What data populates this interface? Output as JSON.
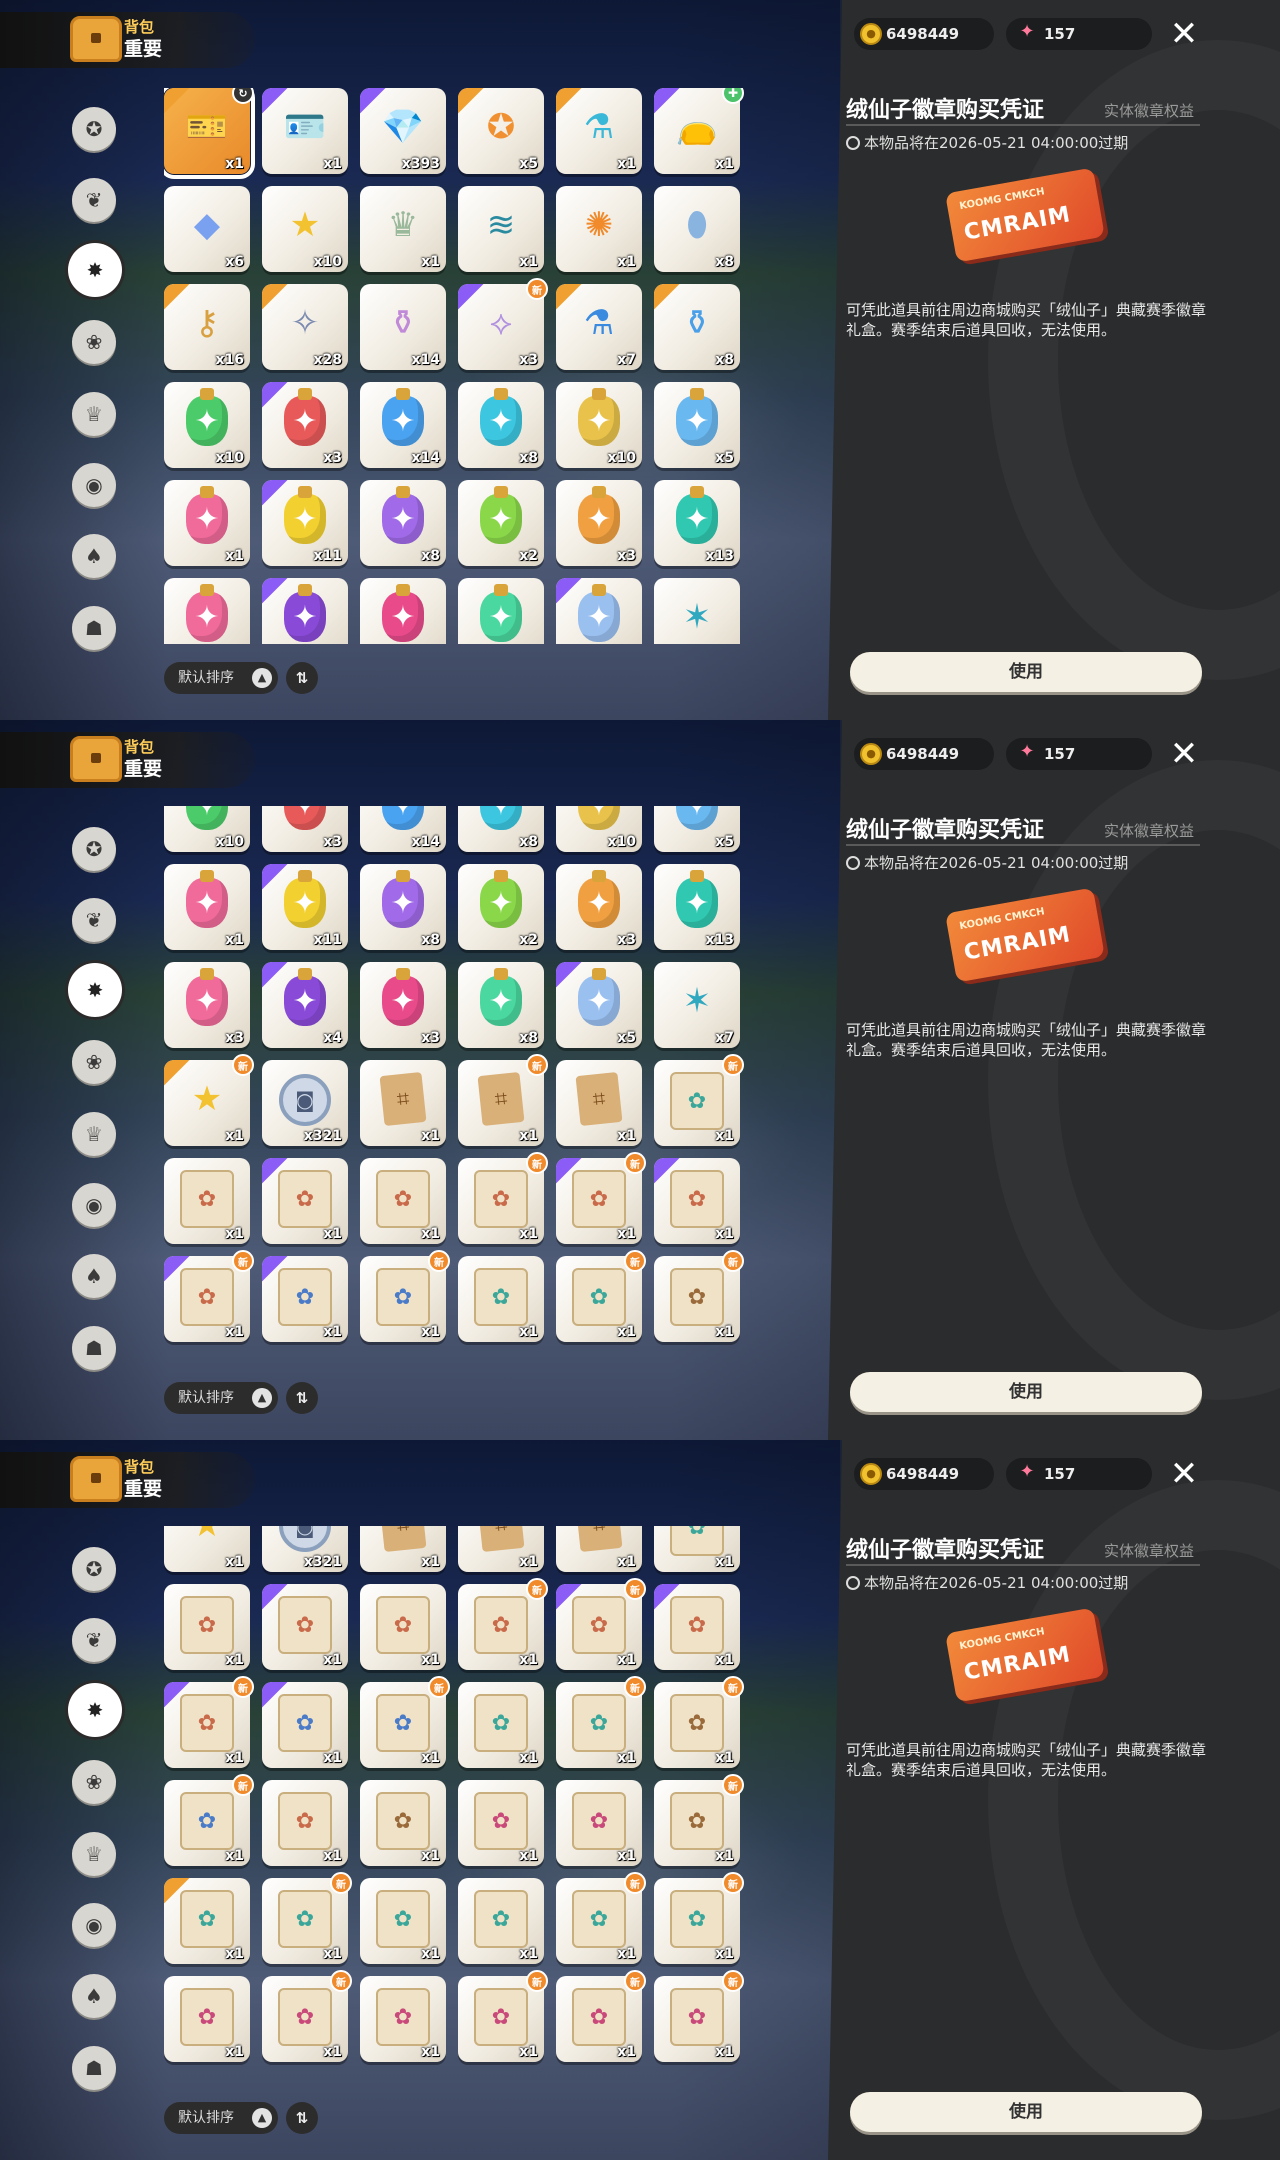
{
  "header": {
    "category": "背包",
    "tab": "重要"
  },
  "currency": {
    "coins": "6498449",
    "gems": "157"
  },
  "sidebar": [
    {
      "icon": "star-badge-icon"
    },
    {
      "icon": "leaf-icon"
    },
    {
      "icon": "compass-star-icon",
      "selected": true
    },
    {
      "icon": "leaf-ball-icon"
    },
    {
      "icon": "crown-card-icon"
    },
    {
      "icon": "ball-icon"
    },
    {
      "icon": "acorn-icon"
    },
    {
      "icon": "chest-face-icon"
    }
  ],
  "sort": {
    "label": "默认排序",
    "direction_icon": "▲",
    "order_icon": "⇅"
  },
  "detail": {
    "title": "绒仙子徽章购买凭证",
    "tag": "实体徽章权益",
    "expiry": "本物品将在2026-05-21 04:00:00过期",
    "ticket_top": "KOOMG CMKCH",
    "ticket_main": "CMRAIM",
    "description": "可凭此道具前往周边商城购买「绒仙子」典藏赛季徽章礼盒。赛季结束后道具回收，无法使用。",
    "use_label": "使用"
  },
  "new_badge": "新",
  "panels": [
    {
      "name": "panel-1",
      "rows": [
        [
          {
            "k": "ticket",
            "c": "x1",
            "r": "r5",
            "sel": true,
            "b": "circle"
          },
          {
            "k": "card",
            "c": "x1",
            "r": "r4"
          },
          {
            "k": "crystal",
            "c": "x393",
            "r": "r4"
          },
          {
            "k": "star-coin",
            "c": "x5",
            "r": "r5"
          },
          {
            "k": "flask",
            "c": "x1",
            "r": "r5"
          },
          {
            "k": "pouch",
            "c": "x1",
            "r": "r4",
            "b": "green"
          }
        ],
        [
          {
            "k": "gem",
            "c": "x6",
            "r": ""
          },
          {
            "k": "star",
            "c": "x10",
            "r": ""
          },
          {
            "k": "crown",
            "c": "x1",
            "r": ""
          },
          {
            "k": "wave",
            "c": "x1",
            "r": ""
          },
          {
            "k": "sunflower",
            "c": "x1",
            "r": ""
          },
          {
            "k": "stone",
            "c": "x8",
            "r": ""
          }
        ],
        [
          {
            "k": "key",
            "c": "x16",
            "r": "r5"
          },
          {
            "k": "wand",
            "c": "x28",
            "r": "r5"
          },
          {
            "k": "rainbow-bottle",
            "c": "x14",
            "r": ""
          },
          {
            "k": "crystal-bottle",
            "c": "x3",
            "r": "r4",
            "b": "new"
          },
          {
            "k": "blue-bottle",
            "c": "x7",
            "r": "r5"
          },
          {
            "k": "blue-potion",
            "c": "x8",
            "r": "r5"
          }
        ],
        [
          {
            "k": "p-green",
            "c": "x10",
            "r": ""
          },
          {
            "k": "p-red",
            "c": "x3",
            "r": "r4"
          },
          {
            "k": "p-blue",
            "c": "x14",
            "r": ""
          },
          {
            "k": "p-cyan",
            "c": "x8",
            "r": ""
          },
          {
            "k": "p-gold",
            "c": "x10",
            "r": ""
          },
          {
            "k": "p-sky",
            "c": "x5",
            "r": ""
          }
        ],
        [
          {
            "k": "p-pink",
            "c": "x1",
            "r": ""
          },
          {
            "k": "p-yellow",
            "c": "x11",
            "r": "r4"
          },
          {
            "k": "p-violet",
            "c": "x8",
            "r": ""
          },
          {
            "k": "p-lime",
            "c": "x2",
            "r": ""
          },
          {
            "k": "p-orange",
            "c": "x3",
            "r": ""
          },
          {
            "k": "p-teal",
            "c": "x13",
            "r": ""
          }
        ],
        [
          {
            "k": "p-pink",
            "c": "",
            "r": ""
          },
          {
            "k": "p-purple",
            "c": "",
            "r": "r4"
          },
          {
            "k": "p-rose",
            "c": "",
            "r": ""
          },
          {
            "k": "p-mint",
            "c": "",
            "r": ""
          },
          {
            "k": "p-swirl",
            "c": "",
            "r": "r4"
          },
          {
            "k": "teal-star",
            "c": "",
            "r": ""
          }
        ]
      ]
    },
    {
      "name": "panel-2",
      "rows": [
        [
          {
            "k": "p-green",
            "c": "x10",
            "r": ""
          },
          {
            "k": "p-red",
            "c": "x3",
            "r": "r4"
          },
          {
            "k": "p-blue",
            "c": "x14",
            "r": ""
          },
          {
            "k": "p-cyan",
            "c": "x8",
            "r": ""
          },
          {
            "k": "p-gold",
            "c": "x10",
            "r": ""
          },
          {
            "k": "p-sky",
            "c": "x5",
            "r": ""
          }
        ],
        [
          {
            "k": "p-pink",
            "c": "x1",
            "r": ""
          },
          {
            "k": "p-yellow",
            "c": "x11",
            "r": "r4"
          },
          {
            "k": "p-violet",
            "c": "x8",
            "r": ""
          },
          {
            "k": "p-lime",
            "c": "x2",
            "r": ""
          },
          {
            "k": "p-orange",
            "c": "x3",
            "r": ""
          },
          {
            "k": "p-teal",
            "c": "x13",
            "r": ""
          }
        ],
        [
          {
            "k": "p-pink",
            "c": "x3",
            "r": ""
          },
          {
            "k": "p-purple",
            "c": "x4",
            "r": "r4"
          },
          {
            "k": "p-rose",
            "c": "x3",
            "r": ""
          },
          {
            "k": "p-mint",
            "c": "x8",
            "r": ""
          },
          {
            "k": "p-swirl",
            "c": "x5",
            "r": "r4"
          },
          {
            "k": "teal-star",
            "c": "x7",
            "r": ""
          }
        ],
        [
          {
            "k": "gold-star",
            "c": "x1",
            "r": "r5",
            "b": "new"
          },
          {
            "k": "coin",
            "c": "x321",
            "r": ""
          },
          {
            "k": "map",
            "c": "x1",
            "r": ""
          },
          {
            "k": "map",
            "c": "x1",
            "r": "",
            "b": "new"
          },
          {
            "k": "map",
            "c": "x1",
            "r": ""
          },
          {
            "k": "scroll-teal",
            "c": "x1",
            "r": "",
            "b": "new"
          }
        ],
        [
          {
            "k": "scroll-red",
            "c": "x1",
            "r": ""
          },
          {
            "k": "scroll-red",
            "c": "x1",
            "r": "r4"
          },
          {
            "k": "scroll-red",
            "c": "x1",
            "r": ""
          },
          {
            "k": "scroll-red",
            "c": "x1",
            "r": "",
            "b": "new"
          },
          {
            "k": "scroll-red",
            "c": "x1",
            "r": "r4",
            "b": "new"
          },
          {
            "k": "scroll-red",
            "c": "x1",
            "r": "r4"
          }
        ],
        [
          {
            "k": "scroll-red",
            "c": "x1",
            "r": "r4",
            "b": "new"
          },
          {
            "k": "scroll-blue",
            "c": "x1",
            "r": "r4"
          },
          {
            "k": "scroll-blue",
            "c": "x1",
            "r": "",
            "b": "new"
          },
          {
            "k": "scroll-teal",
            "c": "x1",
            "r": ""
          },
          {
            "k": "scroll-teal",
            "c": "x1",
            "r": "",
            "b": "new"
          },
          {
            "k": "scroll-brown",
            "c": "x1",
            "r": "",
            "b": "new"
          }
        ]
      ]
    },
    {
      "name": "panel-3",
      "rows": [
        [
          {
            "k": "gold-star",
            "c": "x1",
            "r": "r5"
          },
          {
            "k": "coin",
            "c": "x321",
            "r": ""
          },
          {
            "k": "map",
            "c": "x1",
            "r": ""
          },
          {
            "k": "map",
            "c": "x1",
            "r": ""
          },
          {
            "k": "map",
            "c": "x1",
            "r": ""
          },
          {
            "k": "scroll-teal",
            "c": "x1",
            "r": ""
          }
        ],
        [
          {
            "k": "scroll-red",
            "c": "x1",
            "r": ""
          },
          {
            "k": "scroll-red",
            "c": "x1",
            "r": "r4"
          },
          {
            "k": "scroll-red",
            "c": "x1",
            "r": ""
          },
          {
            "k": "scroll-red",
            "c": "x1",
            "r": "",
            "b": "new"
          },
          {
            "k": "scroll-red",
            "c": "x1",
            "r": "r4",
            "b": "new"
          },
          {
            "k": "scroll-red",
            "c": "x1",
            "r": "r4"
          }
        ],
        [
          {
            "k": "scroll-red",
            "c": "x1",
            "r": "r4",
            "b": "new"
          },
          {
            "k": "scroll-blue",
            "c": "x1",
            "r": "r4"
          },
          {
            "k": "scroll-blue",
            "c": "x1",
            "r": "",
            "b": "new"
          },
          {
            "k": "scroll-teal",
            "c": "x1",
            "r": ""
          },
          {
            "k": "scroll-teal",
            "c": "x1",
            "r": "",
            "b": "new"
          },
          {
            "k": "scroll-brown",
            "c": "x1",
            "r": "",
            "b": "new"
          }
        ],
        [
          {
            "k": "scroll-blue",
            "c": "x1",
            "r": "",
            "b": "new"
          },
          {
            "k": "scroll-red",
            "c": "x1",
            "r": ""
          },
          {
            "k": "scroll-brown",
            "c": "x1",
            "r": ""
          },
          {
            "k": "scroll-pink",
            "c": "x1",
            "r": ""
          },
          {
            "k": "scroll-pink",
            "c": "x1",
            "r": ""
          },
          {
            "k": "scroll-brown",
            "c": "x1",
            "r": "",
            "b": "new"
          }
        ],
        [
          {
            "k": "scroll-teal",
            "c": "x1",
            "r": "r5"
          },
          {
            "k": "scroll-teal",
            "c": "x1",
            "r": "",
            "b": "new"
          },
          {
            "k": "scroll-teal",
            "c": "x1",
            "r": ""
          },
          {
            "k": "scroll-teal",
            "c": "x1",
            "r": ""
          },
          {
            "k": "scroll-teal",
            "c": "x1",
            "r": "",
            "b": "new"
          },
          {
            "k": "scroll-teal",
            "c": "x1",
            "r": "",
            "b": "new"
          }
        ],
        [
          {
            "k": "scroll-pink",
            "c": "x1",
            "r": ""
          },
          {
            "k": "scroll-pink",
            "c": "x1",
            "r": "",
            "b": "new"
          },
          {
            "k": "scroll-pink",
            "c": "x1",
            "r": ""
          },
          {
            "k": "scroll-pink",
            "c": "x1",
            "r": "",
            "b": "new"
          },
          {
            "k": "scroll-pink",
            "c": "x1",
            "r": "",
            "b": "new"
          },
          {
            "k": "scroll-pink",
            "c": "x1",
            "r": "",
            "b": "new"
          }
        ]
      ]
    }
  ]
}
